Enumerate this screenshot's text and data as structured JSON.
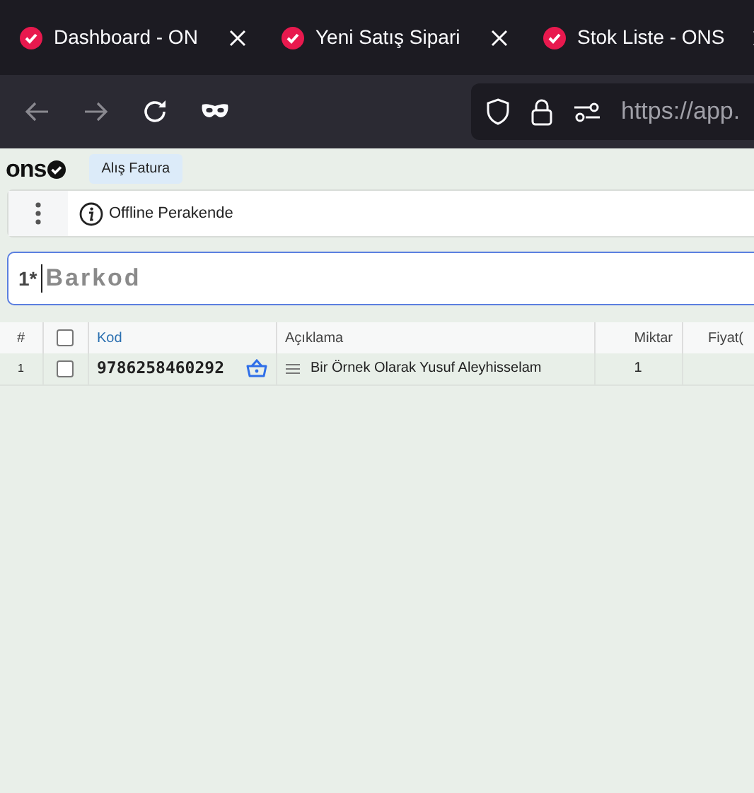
{
  "browser": {
    "tabs": [
      {
        "title": "Dashboard - ON",
        "selected": false
      },
      {
        "title": "Yeni Satış Sipari",
        "selected": false
      },
      {
        "title": "Stok Liste - ONS",
        "selected": false
      }
    ],
    "nav": {
      "back_disabled": true,
      "forward_disabled": true
    },
    "url": "https://app."
  },
  "app": {
    "logo": "ons",
    "page_tabs": [
      {
        "label": "Alış Fatura",
        "selected": true
      }
    ],
    "toolbar": {
      "title": "Offline Perakende"
    },
    "barcode": {
      "label": "1*",
      "placeholder": "Barkod"
    },
    "table": {
      "columns": [
        "#",
        "Kod",
        "Açıklama",
        "Miktar",
        "Fiyat("
      ],
      "rows": [
        {
          "no": "1",
          "checked": false,
          "code": "9786258460292",
          "description": "Bir Örnek Olarak Yusuf Aleyhisselam",
          "quantity": "1"
        }
      ],
      "all_checked": false
    }
  }
}
